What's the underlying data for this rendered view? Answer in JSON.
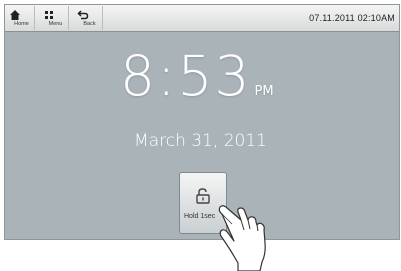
{
  "nav": {
    "home_label": "Home",
    "menu_label": "Menu",
    "back_label": "Back"
  },
  "status": {
    "datetime": "07.11.2011 02:10AM"
  },
  "clock": {
    "time": "8:53",
    "ampm": "PM",
    "date": "March 31, 2011"
  },
  "unlock": {
    "label": "Hold 1sec"
  },
  "icons": {
    "home": "home-icon",
    "menu": "grid-icon",
    "back": "back-arrow-icon",
    "unlock": "unlock-icon",
    "hand": "pointing-hand"
  },
  "colors": {
    "background": "#a9b3b8",
    "topbar": "#e6e8e9",
    "text_light": "#ffffff"
  }
}
